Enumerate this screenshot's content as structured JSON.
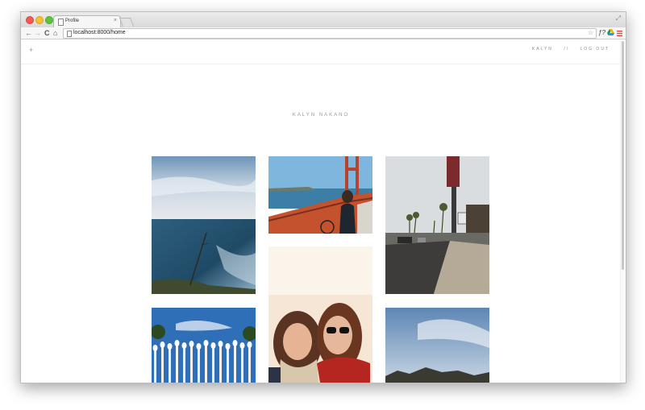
{
  "browser": {
    "tab_title": "Profile",
    "tab_close": "×",
    "url": "localhost:8000/home",
    "nav": {
      "back": "←",
      "forward": "→",
      "reload": "C",
      "home": "⌂"
    },
    "bookmark_star": "☆",
    "ext_script": "ƒ?",
    "expand": "⤢"
  },
  "site": {
    "add_icon": "+",
    "nav": {
      "user": "KALYN",
      "separator": "//",
      "logout": "LOG OUT"
    },
    "profile_name": "KALYN NAKANO"
  },
  "photos": [
    {
      "subject": "ocean-cliff"
    },
    {
      "subject": "golden-gate-bridge"
    },
    {
      "subject": "street-palms"
    },
    {
      "subject": "selfie-friends"
    },
    {
      "subject": "lamp-posts"
    },
    {
      "subject": "hills-sky"
    }
  ],
  "colors": {
    "menu_icon": "#e0473d",
    "nav_text": "#888888",
    "name_text": "#999999"
  }
}
